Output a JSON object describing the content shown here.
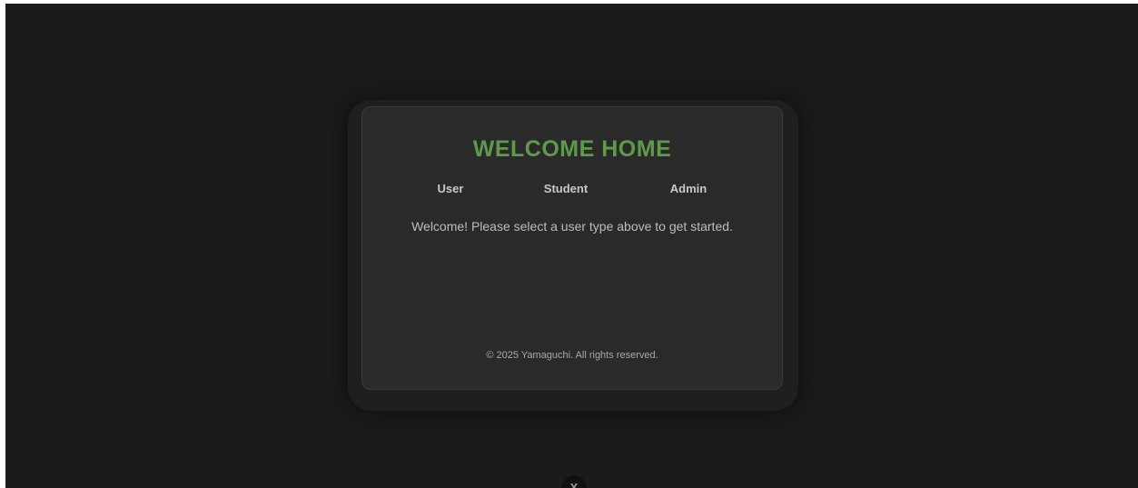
{
  "card": {
    "title": "WELCOME HOME",
    "nav": {
      "user": "User",
      "student": "Student",
      "admin": "Admin"
    },
    "message": "Welcome! Please select a user type above to get started.",
    "footer": "© 2025 Yamaguchi. All rights reserved."
  },
  "close_button": {
    "label": "X",
    "icon": "close-icon"
  },
  "colors": {
    "background": "#1b1b1b",
    "card": "#2a2a2a",
    "accent": "#5f9a4a",
    "text": "#c8c8c8"
  }
}
